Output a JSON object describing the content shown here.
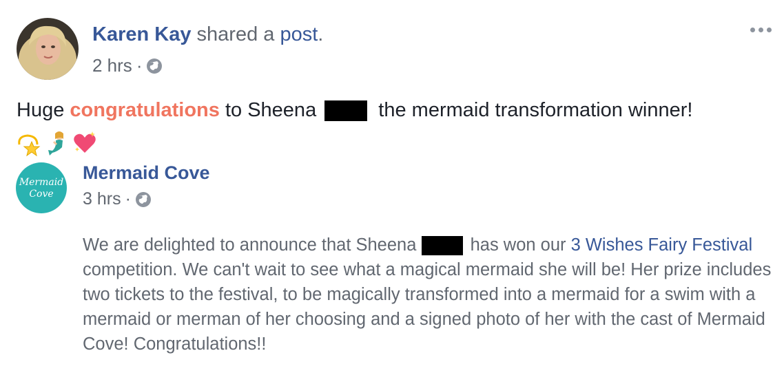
{
  "post": {
    "author": "Karen Kay",
    "action_prefix": " shared a ",
    "action_link": "post",
    "action_suffix": ".",
    "time": "2 hrs",
    "dot": "·",
    "text_before": "Huge ",
    "text_highlight": "congratulations",
    "text_middle": " to Sheena ",
    "text_after": " the mermaid transformation winner!",
    "emojis": [
      "dizzy-emoji",
      "mermaid-emoji",
      "sparkling-heart-emoji"
    ]
  },
  "shared": {
    "page_name": "Mermaid Cove",
    "avatar_text_line1": "Mermaid",
    "avatar_text_line2": "Cove",
    "time": "3 hrs",
    "dot": "·",
    "body_1": "We are delighted to announce that Sheena ",
    "body_2": " has won our ",
    "body_link": "3 Wishes Fairy Festival",
    "body_3": " competition. We can't wait to see what a magical mermaid she will be! Her prize includes two tickets to the festival, to be magically transformed into a mermaid for a swim with a mermaid or merman of her choosing and a signed photo of her with the cast of Mermaid Cove! Congratulations!!"
  },
  "colors": {
    "link": "#385898",
    "highlight": "#f0755f",
    "meta": "#616770",
    "brand_teal": "#2ab3b1"
  }
}
